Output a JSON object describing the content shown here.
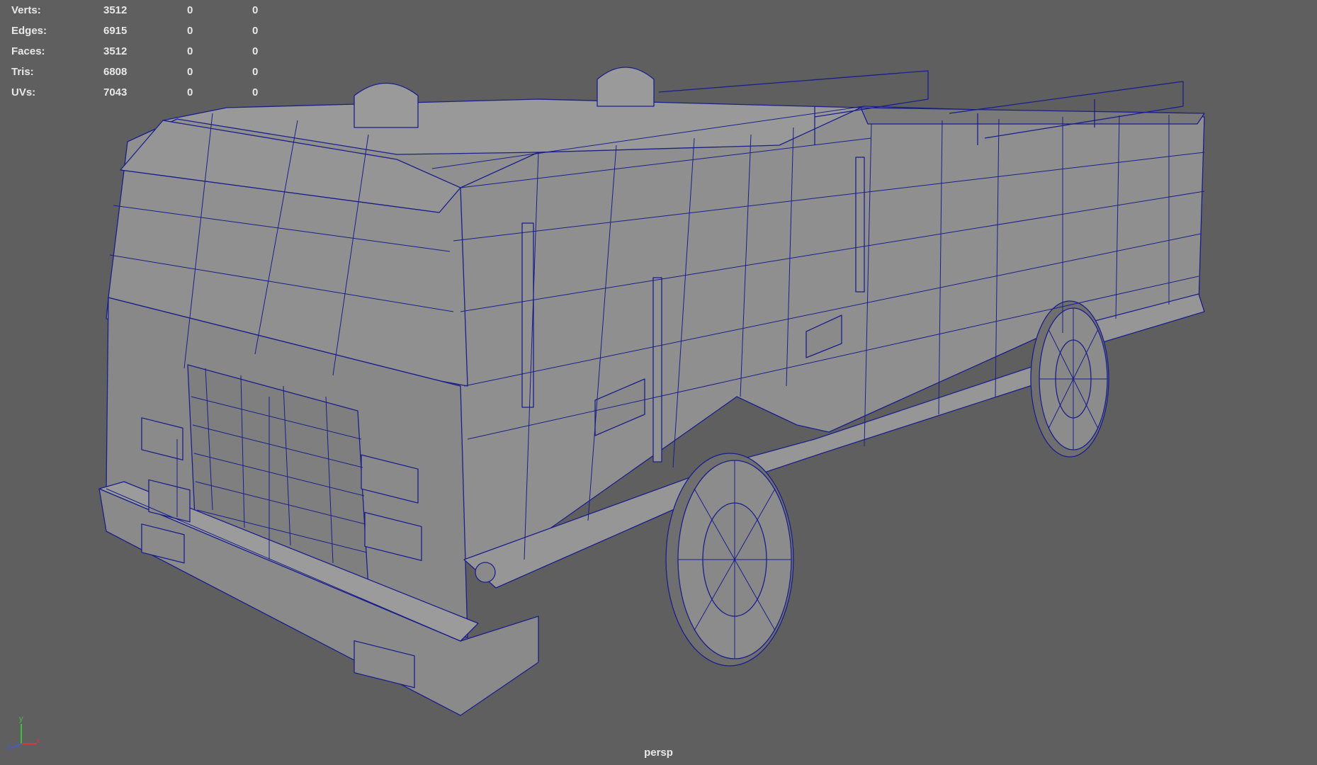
{
  "viewport": {
    "camera_name": "persp",
    "background_color": "#5f5f5f",
    "wire_color": "#1a1f8a",
    "mesh_color": "#8d8d8d"
  },
  "heads_up_display": {
    "rows": [
      {
        "label": "Verts:",
        "values": [
          "3512",
          "0",
          "0"
        ]
      },
      {
        "label": "Edges:",
        "values": [
          "6915",
          "0",
          "0"
        ]
      },
      {
        "label": "Faces:",
        "values": [
          "3512",
          "0",
          "0"
        ]
      },
      {
        "label": "Tris:",
        "values": [
          "6808",
          "0",
          "0"
        ]
      },
      {
        "label": "UVs:",
        "values": [
          "7043",
          "0",
          "0"
        ]
      }
    ]
  },
  "axis_gizmo": {
    "x_label": "x",
    "y_label": "y",
    "z_label": "z",
    "x_color": "#d43a3a",
    "y_color": "#3fbf3f",
    "z_color": "#3f5fd4"
  },
  "model": {
    "icon": "fire-truck-wireframe-mesh"
  }
}
